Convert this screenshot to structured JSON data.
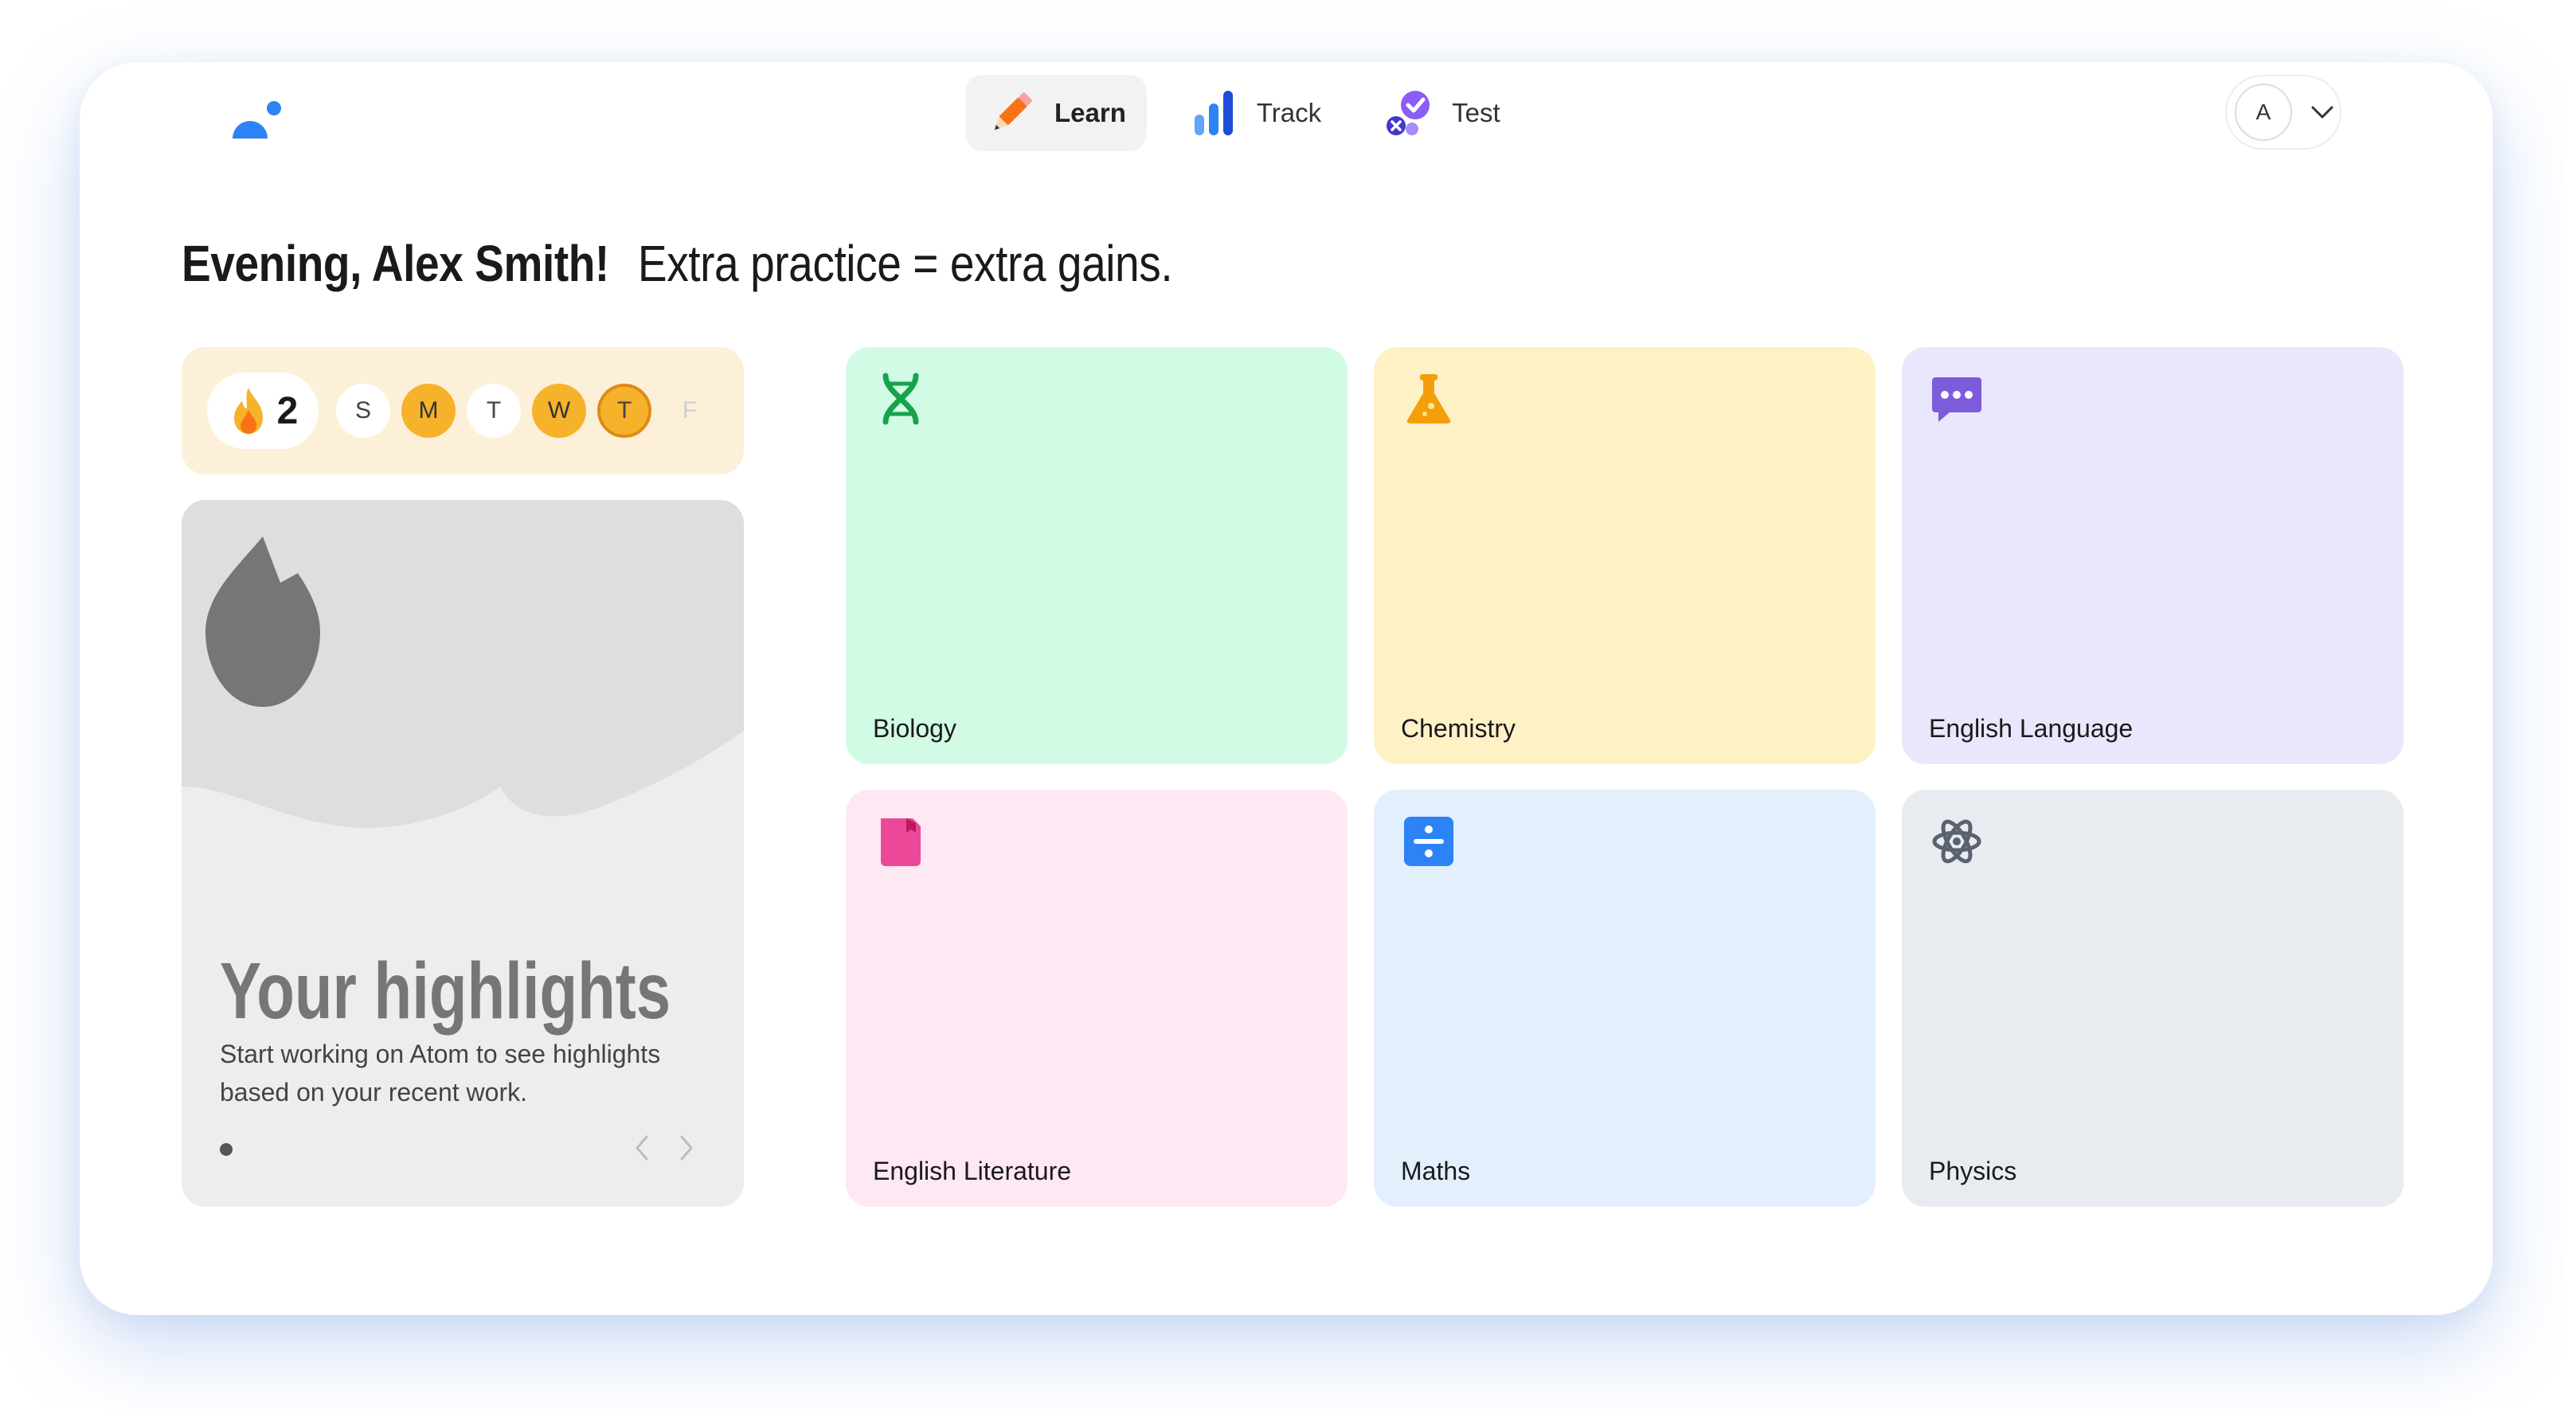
{
  "nav": {
    "tabs": [
      {
        "label": "Learn",
        "icon": "pencil-icon",
        "active": true
      },
      {
        "label": "Track",
        "icon": "bar-chart-icon",
        "active": false
      },
      {
        "label": "Test",
        "icon": "check-cross-icon",
        "active": false
      }
    ]
  },
  "user": {
    "initial": "A"
  },
  "greeting": {
    "text": "Evening, Alex Smith!",
    "tagline": "Extra practice = extra gains."
  },
  "streak": {
    "count": "2",
    "days": [
      {
        "label": "S",
        "state": "none"
      },
      {
        "label": "M",
        "state": "done"
      },
      {
        "label": "T",
        "state": "none"
      },
      {
        "label": "W",
        "state": "done"
      },
      {
        "label": "T",
        "state": "today"
      },
      {
        "label": "F",
        "state": "future"
      }
    ]
  },
  "highlights": {
    "title": "Your highlights",
    "description": "Start working on Atom to see highlights based on your recent work."
  },
  "subjects": [
    {
      "name": "Biology",
      "icon": "dna-icon",
      "bg": "#d2fbe6",
      "color": "#16a34a"
    },
    {
      "name": "Chemistry",
      "icon": "flask-icon",
      "bg": "#fef1c6",
      "color": "#f59e0b"
    },
    {
      "name": "English Language",
      "icon": "speech-bubble-icon",
      "bg": "#e9e7fb",
      "color": "#7c5cdb"
    },
    {
      "name": "English Literature",
      "icon": "book-icon",
      "bg": "#fde8f4",
      "color": "#ec4899"
    },
    {
      "name": "Maths",
      "icon": "divide-icon",
      "bg": "#e3effd",
      "color": "#2b83f6"
    },
    {
      "name": "Physics",
      "icon": "atom-icon",
      "bg": "#e8ebf0",
      "color": "#5a6270"
    }
  ],
  "colors": {
    "accent": "#2b83f6",
    "streak_bg": "#fdf0d9",
    "streak_done": "#f6b22a",
    "highlight_bg": "#ededed"
  }
}
